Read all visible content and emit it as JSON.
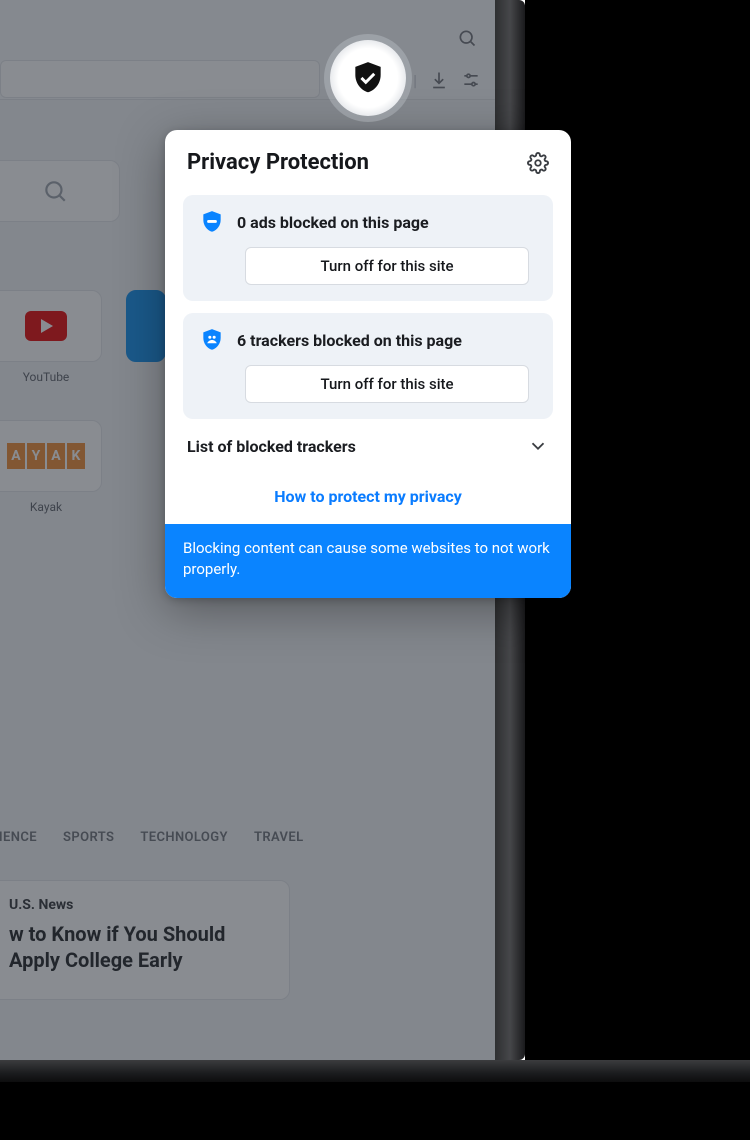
{
  "toolbar": {
    "icons": {
      "search": "search-icon",
      "shield": "shield-check-icon",
      "camera": "camera-icon",
      "download": "download-icon",
      "sliders": "settings-sliders-icon"
    }
  },
  "speeddial": {
    "tiles": [
      {
        "id": "youtube",
        "label": "YouTube"
      },
      {
        "id": "kayak",
        "label": "Kayak",
        "letters": [
          "A",
          "Y",
          "A",
          "K"
        ]
      }
    ]
  },
  "categories": [
    "CIENCE",
    "SPORTS",
    "TECHNOLOGY",
    "TRAVEL"
  ],
  "news": {
    "kicker": "U.S. News",
    "headline": "w to Know if You Should Apply College Early"
  },
  "popover": {
    "title": "Privacy Protection",
    "ads": {
      "count": 0,
      "text": "0 ads blocked on this page",
      "button": "Turn off for this site"
    },
    "trackers": {
      "count": 6,
      "text": "6 trackers blocked on this page",
      "button": "Turn off for this site"
    },
    "list_label": "List of blocked trackers",
    "help_link": "How to protect my privacy",
    "footer": "Blocking content can cause some websites to not work properly."
  }
}
